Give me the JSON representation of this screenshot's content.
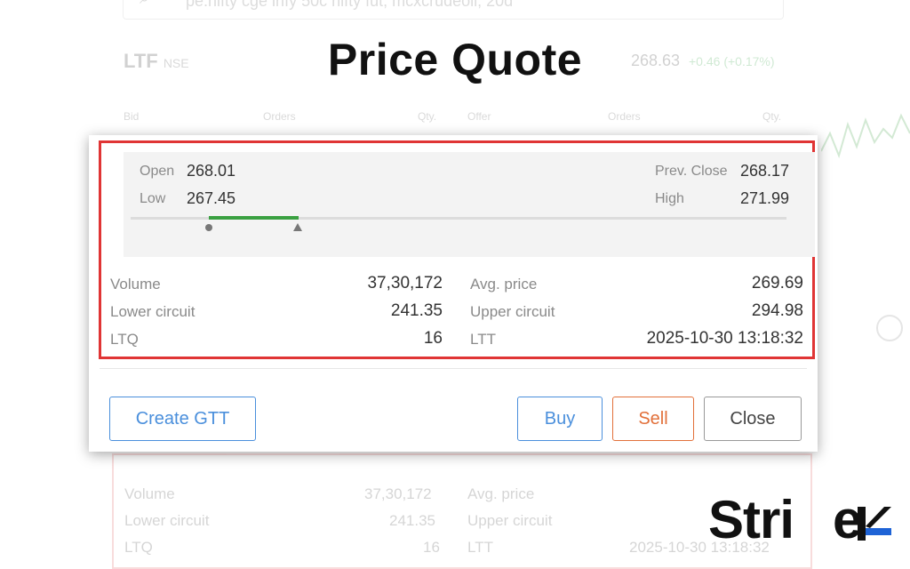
{
  "headline": "Price Quote",
  "background": {
    "search_placeholder": "pe.nifty cge infy 50c nifty fut, mcxcrudeoil, 20d",
    "symbol": "LTF",
    "exchange": "NSE",
    "ltp": "268.63",
    "change": "+0.46 (+0.17%)",
    "depth_headers": [
      "Bid",
      "Orders",
      "Qty.",
      "Offer",
      "Orders",
      "Qty."
    ],
    "ghost_rows": [
      {
        "label": "Volume",
        "value": "37,30,172",
        "label2": "Avg. price",
        "value2": "269.69"
      },
      {
        "label": "Lower circuit",
        "value": "241.35",
        "label2": "Upper circuit",
        "value2": "294.98"
      },
      {
        "label": "LTQ",
        "value": "16",
        "label2": "LTT",
        "value2": "2025-10-30 13:18:32"
      }
    ]
  },
  "quote": {
    "open_label": "Open",
    "open_value": "268.01",
    "low_label": "Low",
    "low_value": "267.45",
    "prev_close_label": "Prev. Close",
    "prev_close_value": "268.17",
    "high_label": "High",
    "high_value": "271.99",
    "stats": [
      {
        "label": "Volume",
        "value": "37,30,172",
        "label2": "Avg. price",
        "value2": "269.69"
      },
      {
        "label": "Lower circuit",
        "value": "241.35",
        "label2": "Upper circuit",
        "value2": "294.98"
      },
      {
        "label": "LTQ",
        "value": "16",
        "label2": "LTT",
        "value2": "2025-10-30 13:18:32"
      }
    ]
  },
  "buttons": {
    "create_gtt": "Create GTT",
    "buy": "Buy",
    "sell": "Sell",
    "close": "Close"
  },
  "brand": {
    "name": "Strike",
    "accent_color": "#1e63d6"
  },
  "colors": {
    "highlight": "#e03535",
    "range_fill": "#3aa041",
    "buy": "#4a8fdc",
    "sell": "#e2703a"
  }
}
